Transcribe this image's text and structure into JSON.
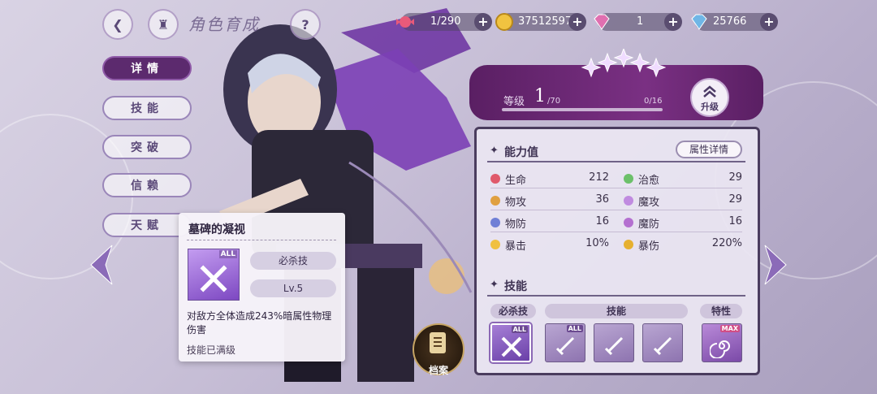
{
  "header": {
    "back_icon": "back-arrow-icon",
    "home_icon": "castle-icon",
    "title": "角色育成",
    "help_label": "?"
  },
  "resources": [
    {
      "icon": "candy-icon",
      "value": "1/290"
    },
    {
      "icon": "gold-coin-icon",
      "value": "37512597"
    },
    {
      "icon": "pink-diamond-icon",
      "value": "1"
    },
    {
      "icon": "blue-diamond-icon",
      "value": "25766"
    }
  ],
  "side_tabs": [
    {
      "label": "详情",
      "active": true
    },
    {
      "label": "技能",
      "active": false
    },
    {
      "label": "突破",
      "active": false
    },
    {
      "label": "信赖",
      "active": false
    },
    {
      "label": "天赋",
      "active": false
    }
  ],
  "level": {
    "label": "等级",
    "current": "1",
    "max": "/70",
    "exp": "0/16",
    "exp_fraction": 0,
    "upgrade_label": "升级"
  },
  "stats": {
    "title": "能力值",
    "detail_button": "属性详情",
    "rows": [
      {
        "name": "生命",
        "value": "212",
        "color": "#e0596b"
      },
      {
        "name": "治愈",
        "value": "29",
        "color": "#6cc06a"
      },
      {
        "name": "物攻",
        "value": "36",
        "color": "#e0a040"
      },
      {
        "name": "魔攻",
        "value": "29",
        "color": "#c08be0"
      },
      {
        "name": "物防",
        "value": "16",
        "color": "#6f7fd6"
      },
      {
        "name": "魔防",
        "value": "16",
        "color": "#b470d0"
      },
      {
        "name": "暴击",
        "value": "10%",
        "color": "#f0c040"
      },
      {
        "name": "暴伤",
        "value": "220%",
        "color": "#e6b030"
      }
    ]
  },
  "skills": {
    "title": "技能",
    "headers": [
      "必杀技",
      "技能",
      "特性"
    ],
    "icons": [
      {
        "name": "ultimate",
        "tag": "ALL"
      },
      {
        "name": "skill-1",
        "tag": "ALL"
      },
      {
        "name": "skill-2",
        "tag": ""
      },
      {
        "name": "skill-3",
        "tag": ""
      },
      {
        "name": "trait",
        "tag": "MAX"
      }
    ]
  },
  "popup": {
    "title": "墓碑的凝视",
    "icon_tag": "ALL",
    "type": "必杀技",
    "level": "Lv.5",
    "description": "对敌方全体造成243%暗属性物理伤害",
    "footer": "技能已满级"
  },
  "archive": {
    "label": "档案"
  },
  "colors": {
    "accent": "#5c2a6e",
    "panel_border": "#4a3c5e"
  }
}
